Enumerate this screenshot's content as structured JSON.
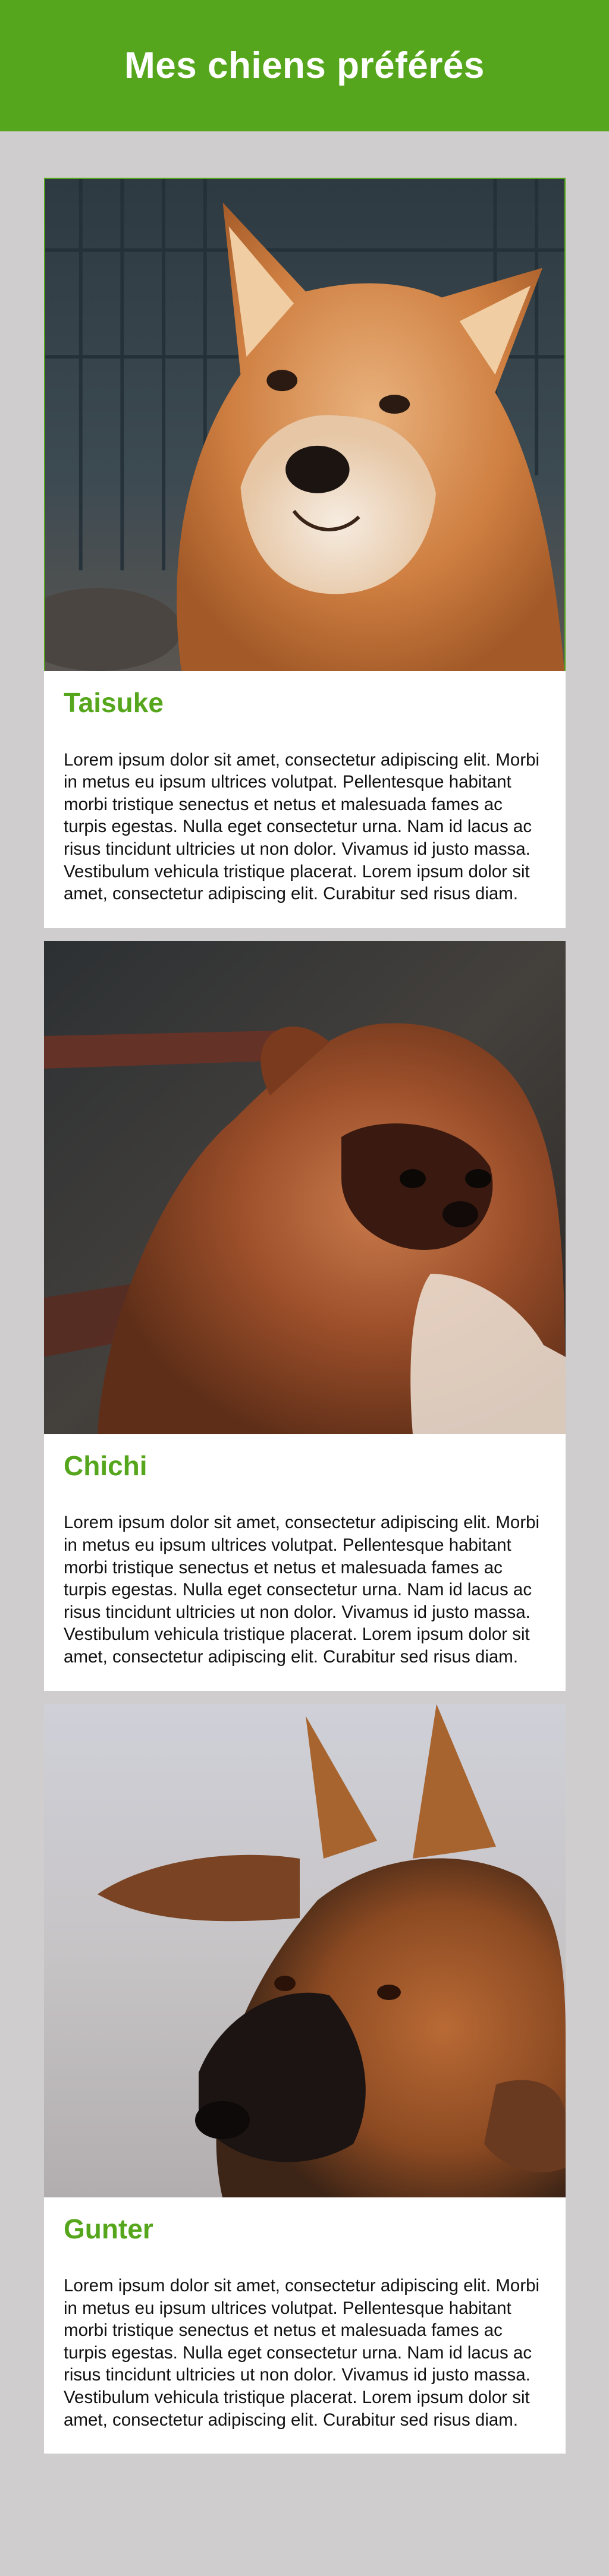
{
  "header": {
    "title": "Mes chiens préférés",
    "background_color": "#55a61c"
  },
  "accent_color": "#55a61c",
  "dogs": [
    {
      "name": "Taisuke",
      "photo_icon": "shiba-inu-photo",
      "description": "Lorem ipsum dolor sit amet, consectetur adipiscing elit. Morbi in metus eu ipsum ultrices volutpat. Pellentesque habitant morbi tristique senectus et netus et malesuada fames ac turpis egestas. Nulla eget consectetur urna. Nam id lacus ac risus tincidunt ultricies ut non dolor. Vivamus id justo massa. Vestibulum vehicula tristique placerat. Lorem ipsum dolor sit amet, consectetur adipiscing elit. Curabitur sed risus diam."
    },
    {
      "name": "Chichi",
      "photo_icon": "pekingese-photo",
      "description": "Lorem ipsum dolor sit amet, consectetur adipiscing elit. Morbi in metus eu ipsum ultrices volutpat. Pellentesque habitant morbi tristique senectus et netus et malesuada fames ac turpis egestas. Nulla eget consectetur urna. Nam id lacus ac risus tincidunt ultricies ut non dolor. Vivamus id justo massa. Vestibulum vehicula tristique placerat. Lorem ipsum dolor sit amet, consectetur adipiscing elit. Curabitur sed risus diam."
    },
    {
      "name": "Gunter",
      "photo_icon": "german-shepherd-photo",
      "description": "Lorem ipsum dolor sit amet, consectetur adipiscing elit. Morbi in metus eu ipsum ultrices volutpat. Pellentesque habitant morbi tristique senectus et netus et malesuada fames ac turpis egestas. Nulla eget consectetur urna. Nam id lacus ac risus tincidunt ultricies ut non dolor. Vivamus id justo massa. Vestibulum vehicula tristique placerat. Lorem ipsum dolor sit amet, consectetur adipiscing elit. Curabitur sed risus diam."
    }
  ]
}
